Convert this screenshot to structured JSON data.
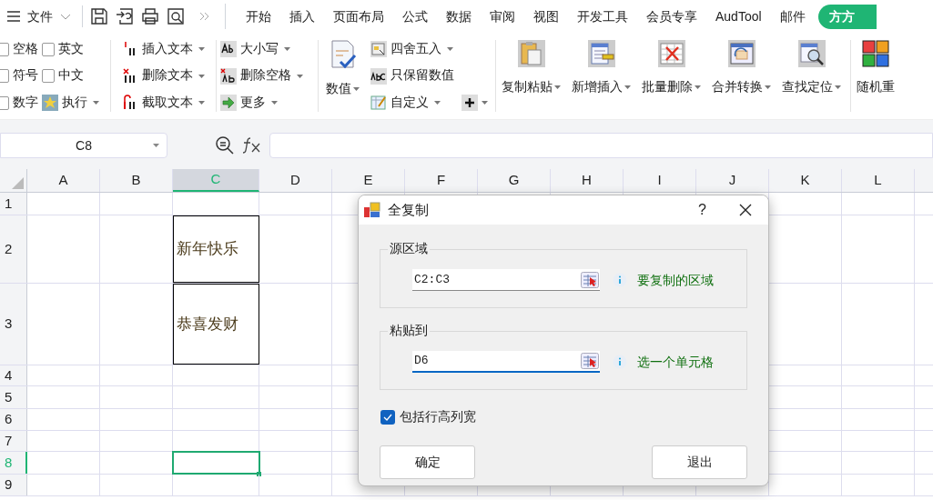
{
  "menu_bar": {
    "file_menu": "文件",
    "tabs": [
      {
        "label": "开始",
        "selected": false
      },
      {
        "label": "插入",
        "selected": false
      },
      {
        "label": "页面布局",
        "selected": false
      },
      {
        "label": "公式",
        "selected": false
      },
      {
        "label": "数据",
        "selected": false
      },
      {
        "label": "审阅",
        "selected": false
      },
      {
        "label": "视图",
        "selected": false
      },
      {
        "label": "开发工具",
        "selected": false
      },
      {
        "label": "会员专享",
        "selected": false
      },
      {
        "label": "AudTool",
        "selected": false
      },
      {
        "label": "邮件",
        "selected": false
      }
    ],
    "badge": "方方"
  },
  "ribbon": {
    "checkboxes": [
      {
        "label": "空格",
        "checked": false
      },
      {
        "label": "英文",
        "checked": false
      },
      {
        "label": "符号",
        "checked": false
      },
      {
        "label": "中文",
        "checked": false
      },
      {
        "label": "数字",
        "checked": false
      }
    ],
    "run_button": "执行",
    "text_tools": [
      {
        "label": "插入文本",
        "kind": "insert"
      },
      {
        "label": "删除文本",
        "kind": "delete"
      },
      {
        "label": "截取文本",
        "kind": "cut"
      }
    ],
    "case_tools": [
      {
        "label": "大小写",
        "kind": "case"
      },
      {
        "label": "删除空格",
        "kind": "space"
      },
      {
        "label": "更多",
        "kind": "more"
      }
    ],
    "number_button": "数值",
    "number_tools": [
      {
        "label": "四舍五入",
        "kind": "round"
      },
      {
        "label": "只保留数值",
        "kind": "keep"
      },
      {
        "label": "自定义",
        "kind": "custom"
      }
    ],
    "large_buttons": [
      {
        "label": "复制粘贴",
        "kind": "paste"
      },
      {
        "label": "新增插入",
        "kind": "insert"
      },
      {
        "label": "批量删除",
        "kind": "delete"
      },
      {
        "label": "合并转换",
        "kind": "merge"
      },
      {
        "label": "查找定位",
        "kind": "find"
      },
      {
        "label": "随机重",
        "kind": "random"
      }
    ]
  },
  "formula_bar": {
    "name_box": "C8"
  },
  "sheet": {
    "columns": [
      {
        "label": "A",
        "selected": false
      },
      {
        "label": "B",
        "selected": false
      },
      {
        "label": "C",
        "selected": true
      },
      {
        "label": "D",
        "selected": false
      },
      {
        "label": "E",
        "selected": false
      },
      {
        "label": "F",
        "selected": false
      },
      {
        "label": "G",
        "selected": false
      },
      {
        "label": "H",
        "selected": false
      },
      {
        "label": "I",
        "selected": false
      },
      {
        "label": "J",
        "selected": false
      },
      {
        "label": "K",
        "selected": false
      },
      {
        "label": "L",
        "selected": false
      }
    ],
    "rows": [
      {
        "label": "1",
        "selected": false
      },
      {
        "label": "2",
        "selected": false,
        "C": "新年快乐"
      },
      {
        "label": "3",
        "selected": false,
        "C": "恭喜发财"
      },
      {
        "label": "4",
        "selected": false
      },
      {
        "label": "5",
        "selected": false
      },
      {
        "label": "6",
        "selected": false
      },
      {
        "label": "7",
        "selected": false
      },
      {
        "label": "8",
        "selected": true
      },
      {
        "label": "9",
        "selected": false
      }
    ]
  },
  "dialog": {
    "title": "全复制",
    "help": "?",
    "groups": [
      {
        "legend": "源区域",
        "value": "C2:C3",
        "hint": "要复制的区域",
        "focused": false
      },
      {
        "legend": "粘贴到",
        "value": "D6",
        "hint": "选一个单元格",
        "focused": true
      }
    ],
    "checkbox": {
      "label": "包括行高列宽",
      "checked": true
    },
    "buttons": [
      "确定",
      "退出"
    ]
  }
}
